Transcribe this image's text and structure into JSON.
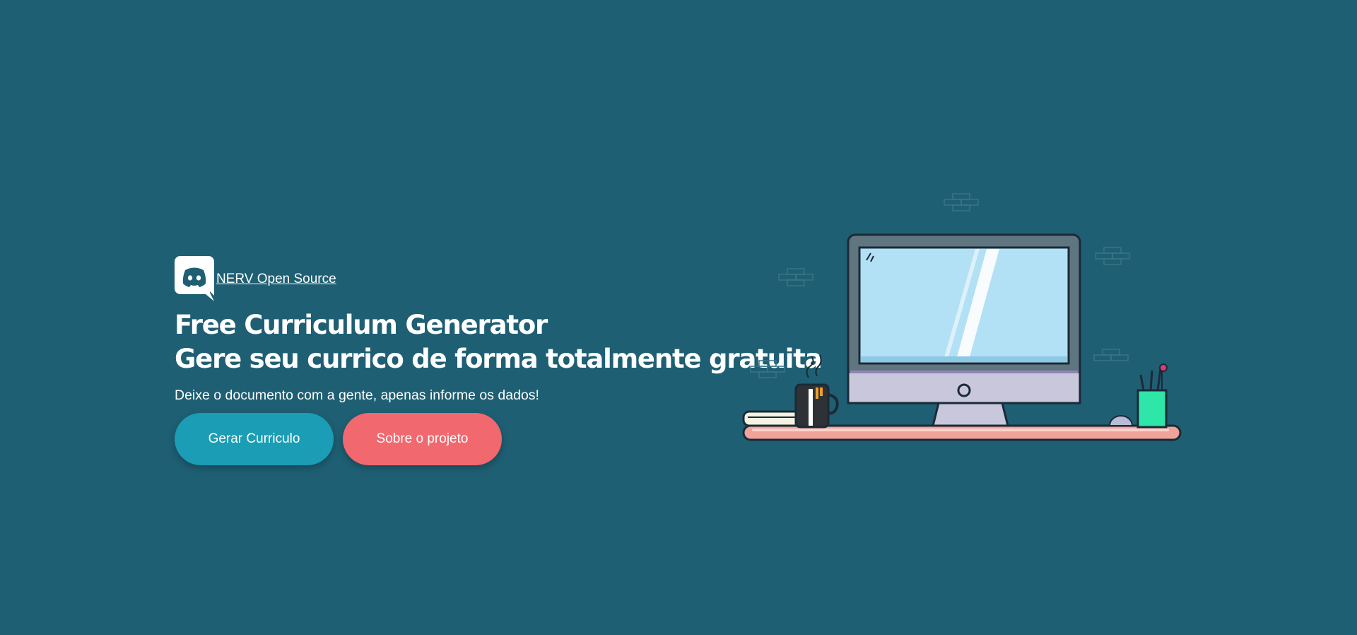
{
  "brand": {
    "icon": "discord-icon",
    "link_label": "NERV Open Source"
  },
  "hero": {
    "title_line1": "Free Curriculum Generator",
    "title_line2": "Gere seu currico de forma totalmente gratuita",
    "subtitle": "Deixe o documento com a gente, apenas informe os dados!"
  },
  "buttons": {
    "primary_label": "Gerar Curriculo",
    "secondary_label": "Sobre o projeto"
  },
  "illustration": {
    "icon": "desk-computer-illustration"
  },
  "colors": {
    "background": "#1f5f73",
    "primary": "#1a9db5",
    "secondary": "#f2686f"
  }
}
